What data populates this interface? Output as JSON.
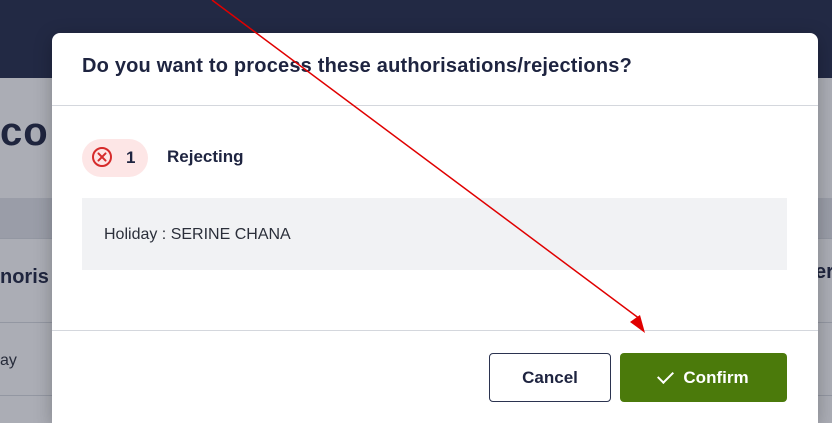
{
  "background": {
    "title_fragment": "co",
    "left_column_fragment": "noris",
    "right_column_fragment": "er",
    "row_cell_fragment": "ay"
  },
  "dialog": {
    "title": "Do you want to process these authorisations/rejections?",
    "rejecting": {
      "icon": "close-circle-icon",
      "count": "1",
      "label": "Rejecting"
    },
    "items": [
      "Holiday : SERINE CHANA"
    ],
    "buttons": {
      "cancel": "Cancel",
      "confirm": "Confirm",
      "confirm_icon": "check-icon"
    }
  },
  "colors": {
    "header_bg": "#232b4a",
    "confirm_bg": "#4b7a0b",
    "reject_icon": "#d62b2b",
    "reject_pill_bg": "#fde6e6",
    "annotation_arrow": "#e00000"
  }
}
